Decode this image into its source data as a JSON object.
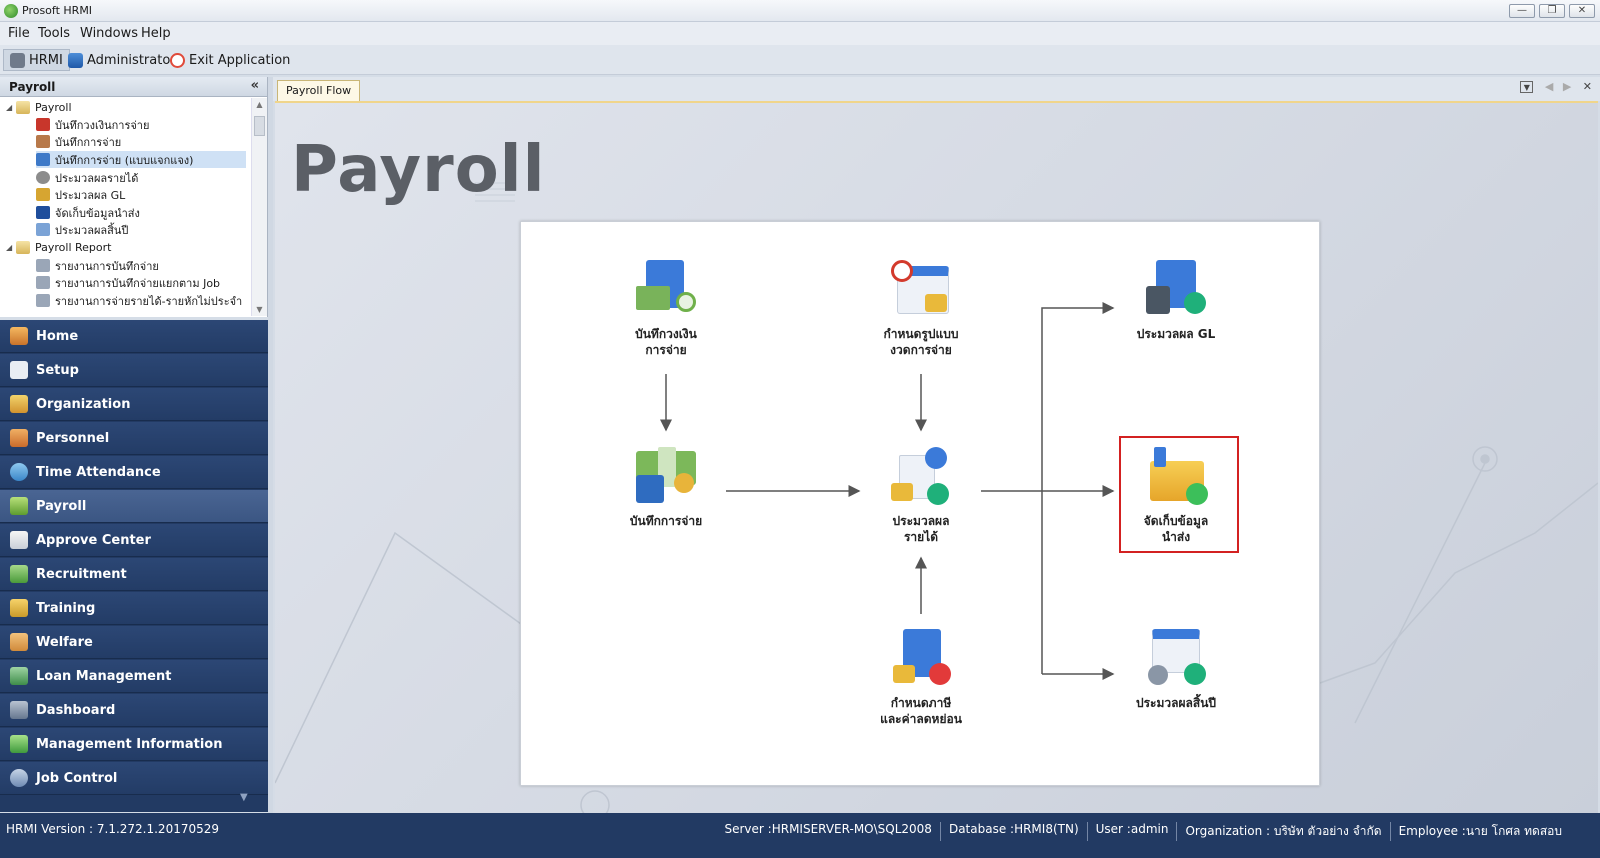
{
  "window": {
    "title": "Prosoft HRMI",
    "min_label": "—",
    "max_label": "❐",
    "close_label": "✕"
  },
  "menu": {
    "items": [
      "File",
      "Tools",
      "Windows",
      "Help"
    ]
  },
  "toolbar": {
    "hrmi": "HRMI",
    "admin": "Administrator",
    "exit": "Exit Application"
  },
  "sidebar": {
    "title": "Payroll",
    "tree": [
      {
        "label": "Payroll",
        "level": 0,
        "group": true
      },
      {
        "label": "บันทึกวงเงินการจ่าย",
        "level": 1
      },
      {
        "label": "บันทึกการจ่าย",
        "level": 1
      },
      {
        "label": "บันทึกการจ่าย (แบบแจกแจง)",
        "level": 1,
        "selected": true
      },
      {
        "label": "ประมวลผลรายได้",
        "level": 1
      },
      {
        "label": "ประมวลผล GL",
        "level": 1
      },
      {
        "label": "จัดเก็บข้อมูลนำส่ง",
        "level": 1
      },
      {
        "label": "ประมวลผลสิ้นปี",
        "level": 1
      },
      {
        "label": "Payroll Report",
        "level": 0,
        "group": true
      },
      {
        "label": "รายงานการบันทึกจ่าย",
        "level": 1
      },
      {
        "label": "รายงานการบันทึกจ่ายแยกตาม Job",
        "level": 1
      },
      {
        "label": "รายงานการจ่ายรายได้-รายหักไม่ประจำ",
        "level": 1
      }
    ]
  },
  "nav": {
    "items": [
      "Home",
      "Setup",
      "Organization",
      "Personnel",
      "Time Attendance",
      "Payroll",
      "Approve Center",
      "Recruitment",
      "Training",
      "Welfare",
      "Loan Management",
      "Dashboard",
      "Management Information",
      "Job Control"
    ],
    "active": "Payroll"
  },
  "tabs": {
    "active": "Payroll Flow"
  },
  "flow": {
    "heading": "Payroll",
    "nodes": {
      "budget": "บันทึกวงเงิน\nการจ่าย",
      "period": "กำหนดรูปแบบ\nงวดการจ่าย",
      "gl": "ประมวลผล GL",
      "payment": "บันทึกการจ่าย",
      "income": "ประมวลผล\nรายได้",
      "submit": "จัดเก็บข้อมูล\nนำส่ง",
      "tax": "กำหนดภาษี\nและค่าลดหย่อน",
      "yearend": "ประมวลผลสิ้นปี"
    },
    "highlighted": "submit"
  },
  "status": {
    "version": "HRMI Version : 7.1.272.1.20170529",
    "server": "Server :HRMISERVER-MO\\SQL2008",
    "database": "Database :HRMI8(TN)",
    "user": "User :admin",
    "organization": "Organization : บริษัท ตัวอย่าง จำกัด",
    "employee": "Employee :นาย โกศล ทดสอบ"
  },
  "colors": {
    "nav_bg": "#223a63",
    "highlight": "#d32121",
    "tab_accent": "#f0d58b"
  }
}
